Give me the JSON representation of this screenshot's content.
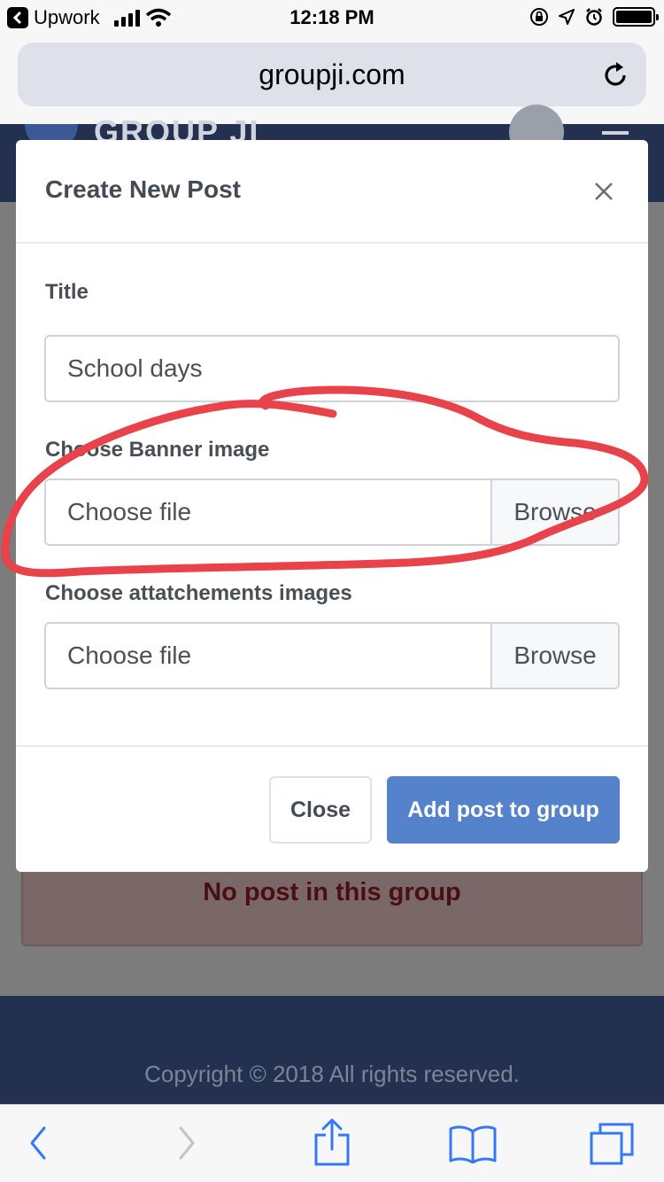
{
  "status_bar": {
    "back_app": "Upwork",
    "time": "12:18 PM"
  },
  "browser": {
    "url": "groupji.com",
    "icons": [
      "reload-icon",
      "back-arrow-icon",
      "forward-arrow-icon",
      "share-icon",
      "bookmarks-icon",
      "tabs-icon"
    ]
  },
  "site": {
    "alert_text": "No post in this group",
    "footer": "Copyright © 2018 All rights reserved."
  },
  "modal": {
    "title": "Create New Post",
    "fields": {
      "title_label": "Title",
      "title_value": "School days",
      "banner_label": "Choose Banner image",
      "banner_placeholder": "Choose file",
      "banner_browse": "Browse",
      "attachments_label": "Choose attatchements images",
      "attachments_placeholder": "Choose file",
      "attachments_browse": "Browse"
    },
    "buttons": {
      "close": "Close",
      "submit": "Add post to group"
    }
  },
  "colors": {
    "primary": "#5483cc",
    "annotation": "#e8424b",
    "header_bg": "#23304f"
  }
}
